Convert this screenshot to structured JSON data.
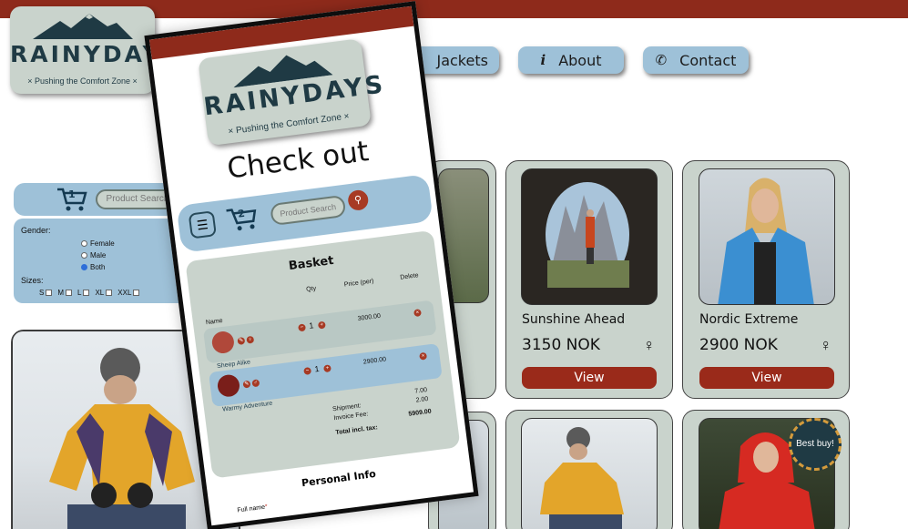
{
  "logo": {
    "brand": "RAINYDAYS",
    "tagline": "× Pushing the Comfort Zone ×"
  },
  "nav": [
    {
      "label": "Jackets",
      "icon": "jacket-icon"
    },
    {
      "label": "About",
      "icon": "info-icon"
    },
    {
      "label": "Contact",
      "icon": "phone-icon"
    }
  ],
  "sidebar": {
    "cart_count": "1",
    "search_placeholder": "Product Search",
    "gender_label": "Gender:",
    "gender_options": [
      "Female",
      "Male",
      "Both"
    ],
    "gender_selected": "Both",
    "sizes_label": "Sizes:",
    "sizes": [
      "S",
      "M",
      "L",
      "XL",
      "XXL"
    ],
    "info_icon": "i"
  },
  "products": [
    {
      "name": "Sunshine Ahead",
      "price": "3150 NOK",
      "gender_symbol": "♀",
      "view_label": "View"
    },
    {
      "name": "Nordic Extreme",
      "price": "2900 NOK",
      "gender_symbol": "♀",
      "view_label": "View"
    }
  ],
  "badge": {
    "text": "Best buy!"
  },
  "phone": {
    "title": "Check out",
    "cart_count": "2",
    "search_placeholder": "Product Search",
    "basket": {
      "title": "Basket",
      "headers": {
        "name": "Name",
        "qty": "Qty",
        "price": "Price (per)",
        "delete": "Delete"
      },
      "items": [
        {
          "name": "Sheep Alike",
          "qty": "1",
          "price": "3000.00"
        },
        {
          "name": "Warmy Adventure",
          "qty": "1",
          "price": "2900.00"
        }
      ],
      "shipment_label": "Shipment:",
      "shipment_value": "7.00",
      "invoice_label": "Invoice Fee:",
      "invoice_value": "2.00",
      "total_label": "Total incl. tax:",
      "total_value": "5909.00"
    },
    "personal_info_title": "Personal Info",
    "full_name_label": "Full name"
  },
  "colors": {
    "accent_red": "#8e2a1b",
    "panel_blue": "#9ec1d8",
    "card_gray": "#c9d3cc",
    "logo_navy": "#1f3a44"
  }
}
